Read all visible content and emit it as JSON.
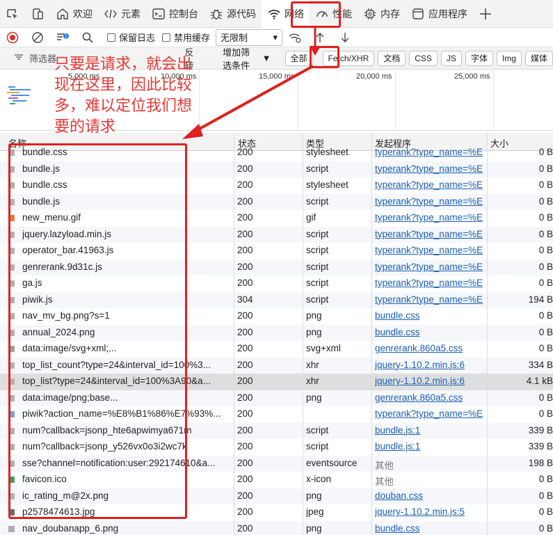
{
  "tabs": [
    {
      "label": "欢迎",
      "icon": "home-icon"
    },
    {
      "label": "元素",
      "icon": "code-icon"
    },
    {
      "label": "控制台",
      "icon": "console-icon"
    },
    {
      "label": "源代码",
      "icon": "bug-icon"
    },
    {
      "label": "网络",
      "icon": "wifi-icon",
      "active": true
    },
    {
      "label": "性能",
      "icon": "gauge-icon"
    },
    {
      "label": "内存",
      "icon": "chip-icon"
    },
    {
      "label": "应用程序",
      "icon": "window-icon"
    }
  ],
  "toolbar": {
    "preserve_log": "保留日志",
    "disable_cache": "禁用缓存",
    "throttle": "无限制"
  },
  "filters": {
    "filter_label": "筛选器",
    "invert": "反转",
    "more_filters": "增加筛选条件",
    "types": [
      "全部",
      "Fetch/XHR",
      "文档",
      "CSS",
      "JS",
      "字体",
      "Img",
      "媒体"
    ]
  },
  "timeline": {
    "ticks": [
      "5,000 ms",
      "10,000 ms",
      "15,000 ms",
      "20,000 ms",
      "25,000 ms"
    ]
  },
  "table": {
    "headers": {
      "name": "名称",
      "status": "状态",
      "type": "类型",
      "initiator": "发起程序",
      "size": "大小"
    },
    "rows": [
      {
        "name": "bundle.css",
        "status": "200",
        "type": "stylesheet",
        "initiator": "typerank?type_name=%E",
        "size": "0 B",
        "link": true
      },
      {
        "name": "bundle.js",
        "status": "200",
        "type": "script",
        "initiator": "typerank?type_name=%E",
        "size": "0 B",
        "link": true
      },
      {
        "name": "bundle.css",
        "status": "200",
        "type": "stylesheet",
        "initiator": "typerank?type_name=%E",
        "size": "0 B",
        "link": true
      },
      {
        "name": "bundle.js",
        "status": "200",
        "type": "script",
        "initiator": "typerank?type_name=%E",
        "size": "0 B",
        "link": true
      },
      {
        "name": "new_menu.gif",
        "status": "200",
        "type": "gif",
        "initiator": "typerank?type_name=%E",
        "size": "0 B",
        "link": true
      },
      {
        "name": "jquery.lazyload.min.js",
        "status": "200",
        "type": "script",
        "initiator": "typerank?type_name=%E",
        "size": "0 B",
        "link": true
      },
      {
        "name": "operator_bar.41963.js",
        "status": "200",
        "type": "script",
        "initiator": "typerank?type_name=%E",
        "size": "0 B",
        "link": true
      },
      {
        "name": "genrerank.9d31c.js",
        "status": "200",
        "type": "script",
        "initiator": "typerank?type_name=%E",
        "size": "0 B",
        "link": true
      },
      {
        "name": "ga.js",
        "status": "200",
        "type": "script",
        "initiator": "typerank?type_name=%E",
        "size": "0 B",
        "link": true
      },
      {
        "name": "piwik.js",
        "status": "304",
        "type": "script",
        "initiator": "typerank?type_name=%E",
        "size": "194 B",
        "link": true
      },
      {
        "name": "nav_mv_bg.png?s=1",
        "status": "200",
        "type": "png",
        "initiator": "bundle.css",
        "size": "0 B",
        "link": true
      },
      {
        "name": "annual_2024.png",
        "status": "200",
        "type": "png",
        "initiator": "bundle.css",
        "size": "0 B",
        "link": true
      },
      {
        "name": "data:image/svg+xml;...",
        "status": "200",
        "type": "svg+xml",
        "initiator": "genrerank.860a5.css",
        "size": "0 B",
        "link": true
      },
      {
        "name": "top_list_count?type=24&interval_id=100%3...",
        "status": "200",
        "type": "xhr",
        "initiator": "jquery-1.10.2.min.js:6",
        "size": "334 B",
        "link": true
      },
      {
        "name": "top_list?type=24&interval_id=100%3A90&a...",
        "status": "200",
        "type": "xhr",
        "initiator": "jquery-1.10.2.min.js:6",
        "size": "4.1 kB",
        "link": true,
        "selected": true
      },
      {
        "name": "data:image/png;base...",
        "status": "200",
        "type": "png",
        "initiator": "genrerank.860a5.css",
        "size": "0 B",
        "link": true
      },
      {
        "name": "piwik?action_name=%E8%B1%86%E7%93%...",
        "status": "200",
        "type": "",
        "initiator": "typerank?type_name=%E",
        "size": "0 B",
        "link": true
      },
      {
        "name": "num?callback=jsonp_hte6apwimya671m",
        "status": "200",
        "type": "script",
        "initiator": "bundle.js:1",
        "size": "339 B",
        "link": true
      },
      {
        "name": "num?callback=jsonp_y526vx0o3i2wc7k",
        "status": "200",
        "type": "script",
        "initiator": "bundle.js:1",
        "size": "339 B",
        "link": true
      },
      {
        "name": "sse?channel=notification:user:292174610&a...",
        "status": "200",
        "type": "eventsource",
        "initiator": "其他",
        "size": "198 B",
        "link": false
      },
      {
        "name": "favicon.ico",
        "status": "200",
        "type": "x-icon",
        "initiator": "其他",
        "size": "0 B",
        "link": false
      },
      {
        "name": "ic_rating_m@2x.png",
        "status": "200",
        "type": "png",
        "initiator": "douban.css",
        "size": "0 B",
        "link": true
      },
      {
        "name": "p2578474613.jpg",
        "status": "200",
        "type": "jpeg",
        "initiator": "jquery-1.10.2.min.js:5",
        "size": "0 B",
        "link": true
      },
      {
        "name": "nav_doubanapp_6.png",
        "status": "200",
        "type": "png",
        "initiator": "bundle.css",
        "size": "0 B",
        "link": true
      }
    ]
  },
  "annotation": {
    "text": "只要是请求，就会出现在这里，因此比较多，难以定位我们想要的请求",
    "color": "#e53935"
  }
}
